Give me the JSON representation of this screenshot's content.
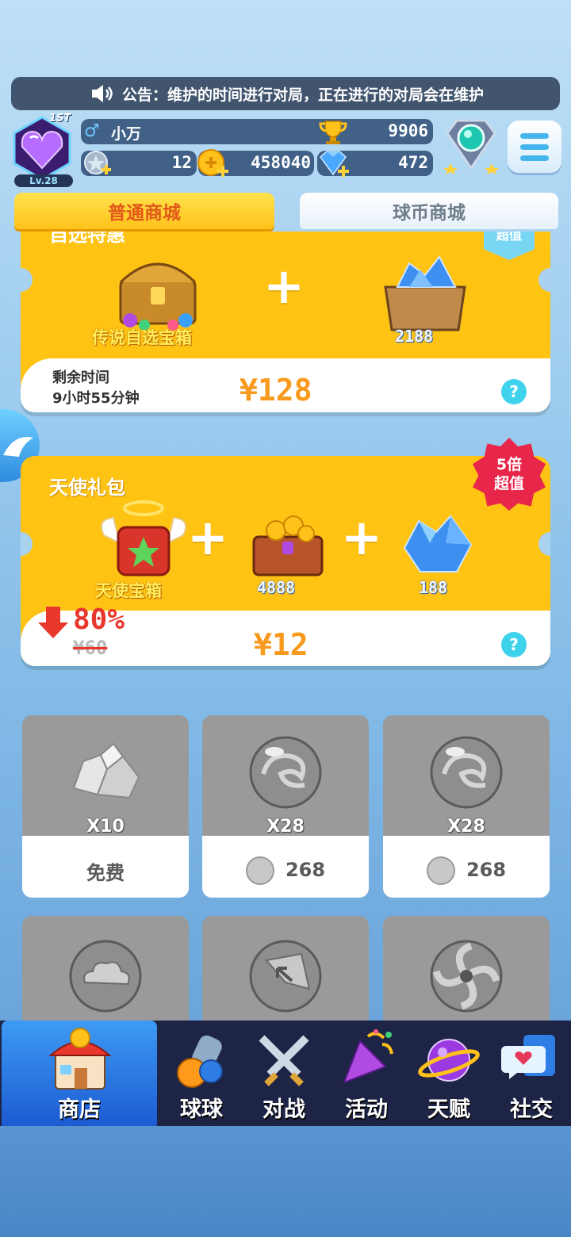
{
  "notice": {
    "text": "公告：维护的时间进行对局，正在进行的对局会在维护"
  },
  "player": {
    "name": "小万",
    "trophies": "9906",
    "level": "Lv.28",
    "rank_badge": "1ST",
    "stars": "12",
    "coins": "458040",
    "gems": "472"
  },
  "tabs": [
    {
      "label": "普通商城"
    },
    {
      "label": "球币商城"
    }
  ],
  "offer1": {
    "title": "自选特惠",
    "corner_tag": "超值",
    "item1_label": "传说自选宝箱",
    "item2_label": "2188",
    "timer_label": "剩余时间",
    "timer_value": "9小时55分钟",
    "price": "¥128",
    "help": "?"
  },
  "offer2": {
    "title": "天使礼包",
    "badge_line1": "5倍",
    "badge_line2": "超值",
    "item1_label": "天使宝箱",
    "item2_label": "4888",
    "item3_label": "188",
    "discount": "80%",
    "original_price": "¥60",
    "price": "¥12",
    "help": "?"
  },
  "shop_items": [
    {
      "qty": "X10",
      "cost": "免费",
      "icon": "crystal-rock-icon"
    },
    {
      "qty": "X28",
      "cost": "268",
      "icon": "swirl-ball-icon"
    },
    {
      "qty": "X28",
      "cost": "268",
      "icon": "swirl-ball-icon"
    },
    {
      "qty": "",
      "cost": "",
      "icon": "cloud-ball-icon"
    },
    {
      "qty": "",
      "cost": "",
      "icon": "arrow-ball-icon"
    },
    {
      "qty": "",
      "cost": "",
      "icon": "vortex-ball-icon"
    }
  ],
  "nav": [
    {
      "label": "商店",
      "icon": "shop-icon"
    },
    {
      "label": "球球",
      "icon": "balls-icon"
    },
    {
      "label": "对战",
      "icon": "crossed-swords-icon"
    },
    {
      "label": "活动",
      "icon": "party-popper-icon"
    },
    {
      "label": "天赋",
      "icon": "planet-icon"
    },
    {
      "label": "社交",
      "icon": "chat-heart-icon"
    }
  ],
  "colors": {
    "accent": "#ffc313",
    "tab_active_text": "#e0581a",
    "nav_bg": "#1e2446",
    "nav_active": "#2f7ee6"
  }
}
